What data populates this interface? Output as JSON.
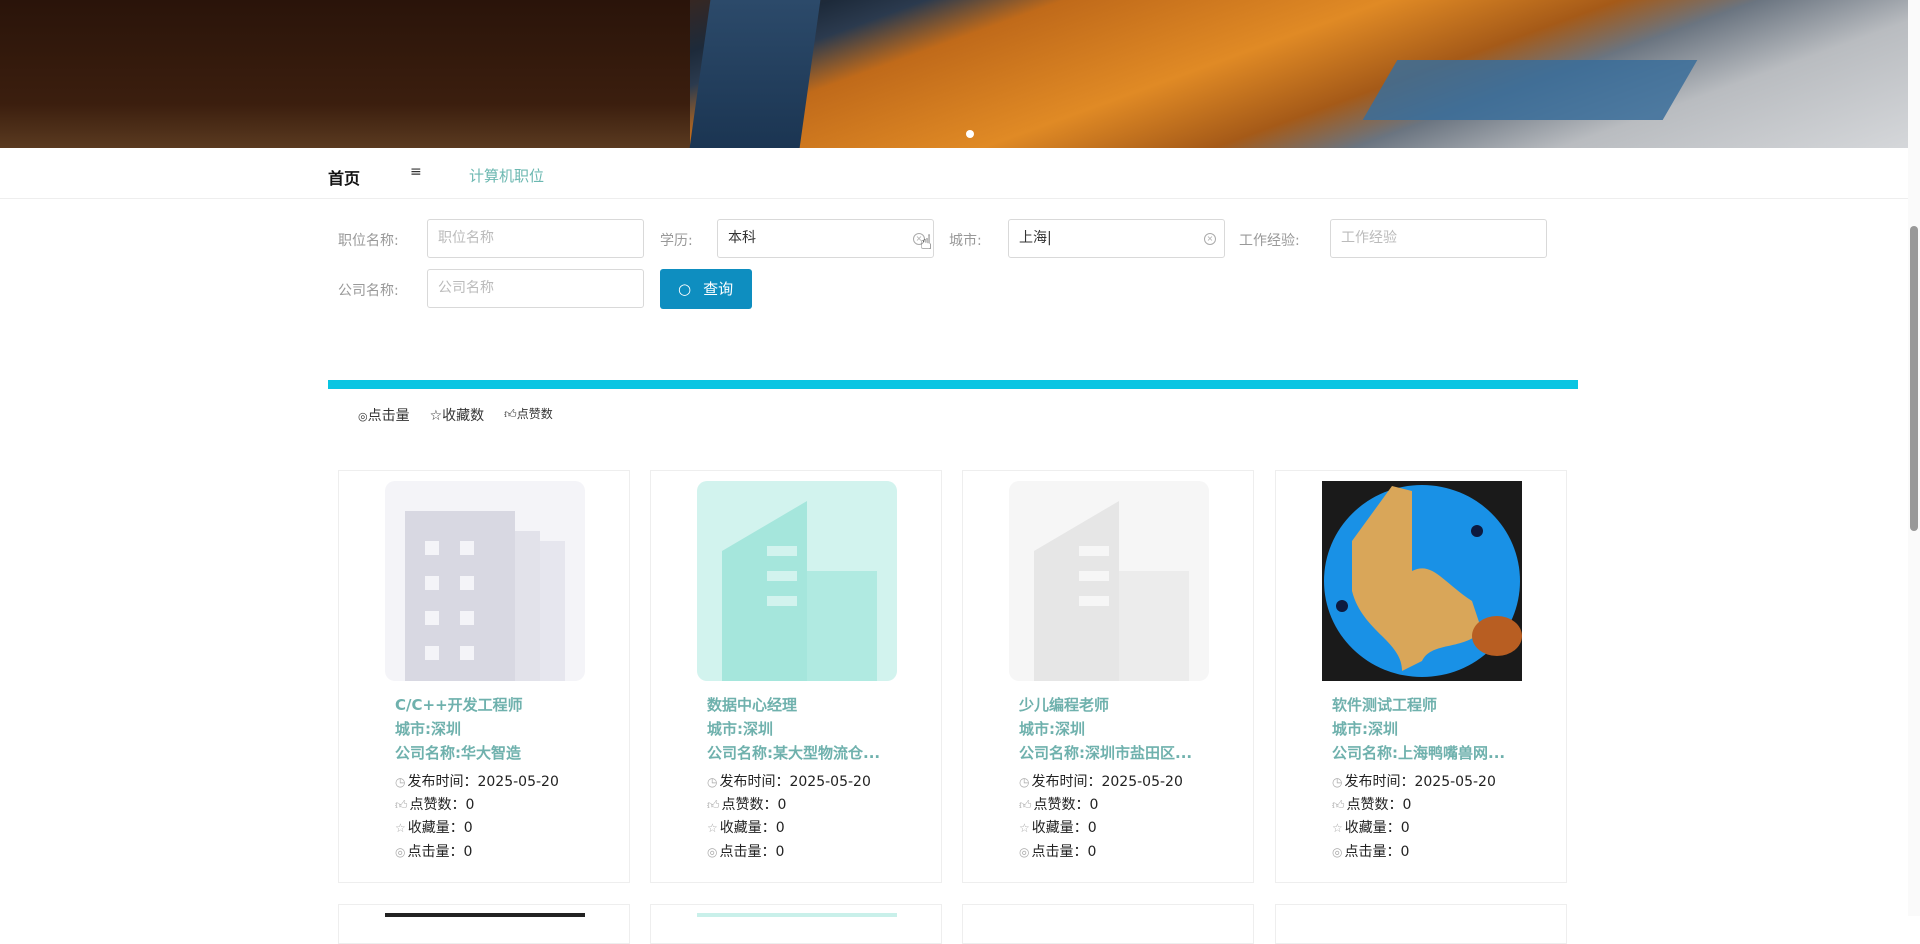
{
  "nav": {
    "home": "首页",
    "menu_icon": "≡",
    "category": "计算机职位"
  },
  "search": {
    "job_label": "职位名称:",
    "job_placeholder": "职位名称",
    "edu_label": "学历:",
    "edu_value": "本科",
    "city_label": "城市:",
    "city_value": "上海",
    "exp_label": "工作经验:",
    "exp_placeholder": "工作经验",
    "company_label": "公司名称:",
    "company_placeholder": "公司名称",
    "query_button": "查询"
  },
  "sort": {
    "clicks": "点击量",
    "favorites": "收藏数",
    "likes": "点赞数"
  },
  "cards": [
    {
      "title": "C/C++开发工程师",
      "city": "城市:深圳",
      "company": "公司名称:华大智造",
      "published": "发布时间：2025-05-20",
      "likes": "点赞数：0",
      "favorites": "收藏量：0",
      "clicks": "点击量：0"
    },
    {
      "title": "数据中心经理",
      "city": "城市:深圳",
      "company": "公司名称:某大型物流仓...",
      "published": "发布时间：2025-05-20",
      "likes": "点赞数：0",
      "favorites": "收藏量：0",
      "clicks": "点击量：0"
    },
    {
      "title": "少儿编程老师",
      "city": "城市:深圳",
      "company": "公司名称:深圳市盐田区...",
      "published": "发布时间：2025-05-20",
      "likes": "点赞数：0",
      "favorites": "收藏量：0",
      "clicks": "点击量：0"
    },
    {
      "title": "软件测试工程师",
      "city": "城市:深圳",
      "company": "公司名称:上海鸭嘴兽网...",
      "published": "发布时间：2025-05-20",
      "likes": "点赞数：0",
      "favorites": "收藏量：0",
      "clicks": "点击量：0"
    }
  ],
  "colors": {
    "accent": "#09c5e2",
    "button": "#0e8ec0",
    "title": "#6fb1ad"
  }
}
